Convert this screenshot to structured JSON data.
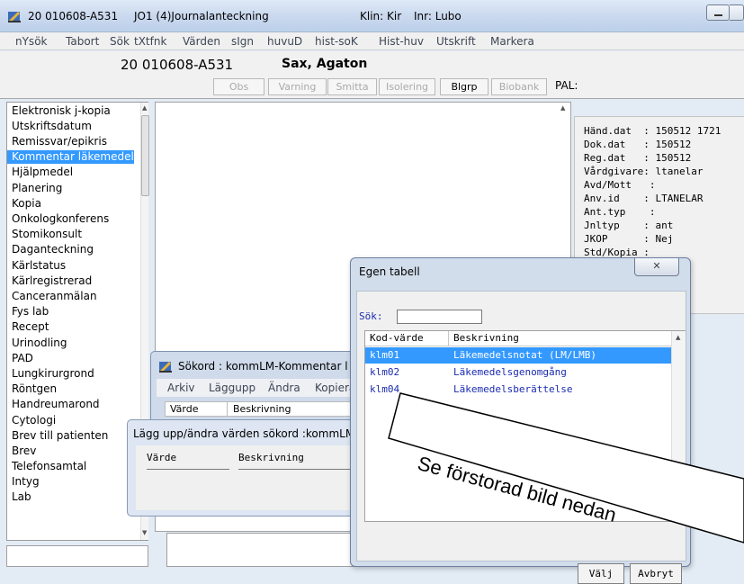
{
  "titlebar": {
    "patient_id": "20 010608-A531",
    "journal": "JO1 (4)Journalanteckning",
    "clinic": "Klin: Kir",
    "unit": "Inr: Lubo"
  },
  "menu": [
    "nYsök",
    "Tabort",
    "Sök",
    "tXtfnk",
    "Värden",
    "sIgn",
    "huvuD",
    "hist-soK",
    "Hist-huv",
    "Utskrift",
    "Markera"
  ],
  "patient": {
    "id": "20 010608-A531",
    "name": "Sax, Agaton",
    "flags": [
      "Obs",
      "Varning",
      "Smitta",
      "Isolering",
      "Blgrp",
      "Biobank"
    ],
    "pal_label": "PAL:"
  },
  "left_list": {
    "items": [
      "Elektronisk j-kopia",
      "Utskriftsdatum",
      "Remissvar/epikris",
      "Kommentar läkemedel",
      "Hjälpmedel",
      "Planering",
      "Kopia",
      "Onkologkonferens",
      "Stomikonsult",
      "Daganteckning",
      "Kärlstatus",
      "Kärlregistrerad",
      "Canceranmälan",
      "Fys lab",
      "Recept",
      "Urinodling",
      "PAD",
      "Lungkirurgrond",
      "Röntgen",
      "Handreumarond",
      "Cytologi",
      "Brev till patienten",
      "Brev",
      "Telefonsamtal",
      "Intyg",
      "Lab"
    ],
    "selected_index": 3
  },
  "info_pane": {
    "lines": [
      "Händ.dat  : 150512 1721",
      "Dok.dat   : 150512",
      "Reg.dat   : 150512",
      "Vårdgivare: ltanelar",
      "Avd/Mott   :",
      "Anv.id    : LTANELAR",
      "Ant.typ    :",
      "Jnltyp    : ant",
      "JKOP      : Nej",
      "Std/Kopia :"
    ]
  },
  "sokord_window": {
    "title": "Sökord : kommLM-Kommentar l",
    "menu": [
      "Arkiv",
      "Läggupp",
      "Ändra",
      "Kopiera"
    ],
    "columns": [
      "Värde",
      "Beskrivning"
    ]
  },
  "lagg_window": {
    "title": "Lägg upp/ändra värden sökord :kommLM",
    "columns": [
      "Värde",
      "Beskrivning"
    ]
  },
  "egen_tabell": {
    "title": "Egen tabell",
    "search_label": "Sök:",
    "search_value": "",
    "columns": [
      "Kod-värde",
      "Beskrivning"
    ],
    "rows": [
      {
        "code": "klm01",
        "desc": "Läkemedelsnotat (LM/LMB)"
      },
      {
        "code": "klm02",
        "desc": "Läkemedelsgenomgång"
      },
      {
        "code": "klm04",
        "desc": "Läkemedelsberättelse"
      }
    ],
    "selected_index": 0,
    "ok_label": "Välj",
    "cancel_label": "Avbryt"
  },
  "callout": {
    "text": "Se förstorad bild nedan"
  }
}
